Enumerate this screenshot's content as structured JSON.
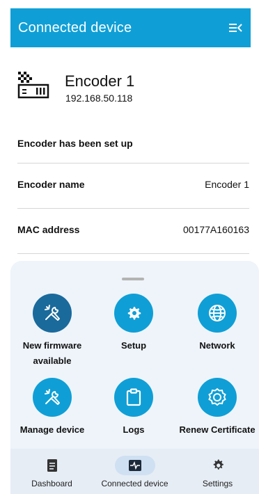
{
  "appbar": {
    "title": "Connected device",
    "menu_icon": "menu-collapse-icon",
    "color": "#0f9fd6"
  },
  "device": {
    "name": "Encoder 1",
    "ip": "192.168.50.118",
    "icon": "encoder-icon"
  },
  "status": "Encoder has been set up",
  "rows": [
    {
      "key": "Encoder name",
      "value": "Encoder 1"
    },
    {
      "key": "MAC address",
      "value": "00177A160163"
    }
  ],
  "actions": [
    {
      "label_line1": "New firmware",
      "label_line2": "available",
      "icon": "tools-icon",
      "style": "dark"
    },
    {
      "label_line1": "Setup",
      "icon": "gear-icon",
      "style": "light"
    },
    {
      "label_line1": "Network",
      "icon": "globe-icon",
      "style": "light"
    },
    {
      "label_line1": "Manage device",
      "icon": "tools-icon",
      "style": "light"
    },
    {
      "label_line1": "Logs",
      "icon": "clipboard-icon",
      "style": "light"
    },
    {
      "label_line1": "Renew Certificate",
      "icon": "certificate-icon",
      "style": "light"
    }
  ],
  "nav": {
    "items": [
      {
        "label": "Dashboard",
        "icon": "document-icon"
      },
      {
        "label": "Connected device",
        "icon": "pulse-icon",
        "active": true
      },
      {
        "label": "Settings",
        "icon": "gear-icon"
      }
    ]
  }
}
